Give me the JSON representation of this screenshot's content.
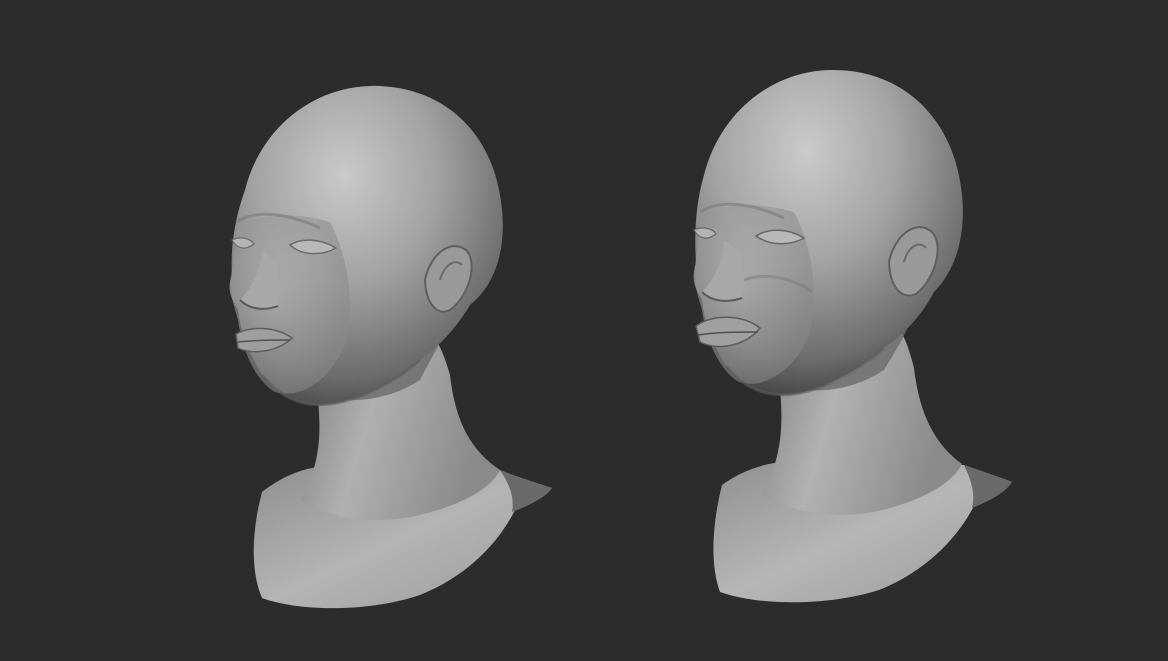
{
  "scene": {
    "background_color": "#2c2c2c",
    "clay_base_color": "#9a9a9a",
    "clay_light_color": "#c4c4c4",
    "clay_shadow_color": "#3e3e3e"
  },
  "models": [
    {
      "name": "bust-left",
      "variant": "softer-features"
    },
    {
      "name": "bust-right",
      "variant": "sharper-features"
    }
  ]
}
